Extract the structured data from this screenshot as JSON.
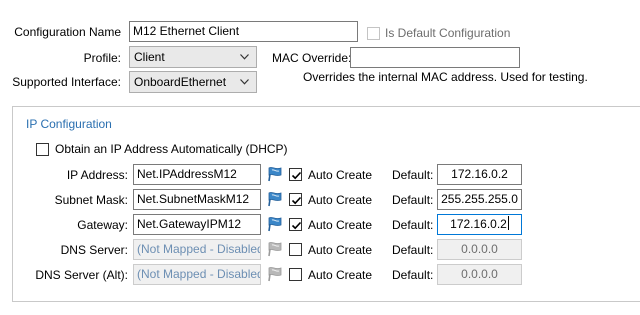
{
  "config": {
    "name_label": "Configuration Name",
    "name_value": "M12 Ethernet Client",
    "is_default_label": "Is Default Configuration",
    "is_default_checked": false,
    "profile_label": "Profile:",
    "profile_value": "Client",
    "mac_override_label": "MAC Override:",
    "mac_override_value": "",
    "interface_label": "Supported Interface:",
    "interface_value": "OnboardEthernet",
    "mac_hint": "Overrides the internal MAC address.  Used for testing."
  },
  "ip": {
    "group_title": "IP Configuration",
    "dhcp_label": "Obtain an IP Address Automatically (DHCP)",
    "dhcp_checked": false,
    "auto_create_label": "Auto Create",
    "default_label": "Default:",
    "rows": [
      {
        "label": "IP Address:",
        "mapping": "Net.IPAddressM12",
        "auto_create": true,
        "default": "172.16.0.2"
      },
      {
        "label": "Subnet Mask:",
        "mapping": "Net.SubnetMaskM12",
        "auto_create": true,
        "default": "255.255.255.0"
      },
      {
        "label": "Gateway:",
        "mapping": "Net.GatewayIPM12",
        "auto_create": true,
        "default": "172.16.0.2"
      },
      {
        "label": "DNS Server:",
        "mapping": "(Not Mapped - Disabled)",
        "auto_create": false,
        "default": "0.0.0.0"
      },
      {
        "label": "DNS Server (Alt):",
        "mapping": "(Not Mapped - Disabled)",
        "auto_create": false,
        "default": "0.0.0.0"
      }
    ]
  },
  "colors": {
    "accent": "#2a6fb0",
    "focus_border": "#0078d7",
    "pin_blue": "#3a86c8",
    "disabled_bg": "#f0f0f0"
  }
}
